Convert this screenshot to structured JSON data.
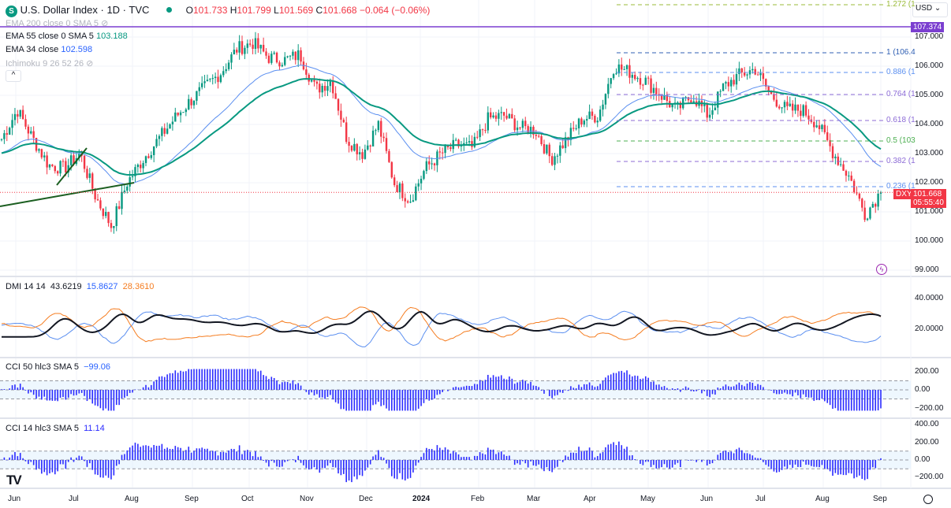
{
  "header": {
    "symbol_badge": "S",
    "title": "U.S. Dollar Index · 1D · TVC",
    "o_label": "O",
    "o": "101.733",
    "h_label": "H",
    "h": "101.799",
    "l_label": "L",
    "l": "101.569",
    "c_label": "C",
    "c": "101.668",
    "change": "−0.064 (−0.06%)"
  },
  "legend": {
    "ema200": "EMA 200 close 0 SMA 5",
    "ema55": "EMA 55 close 0 SMA 5",
    "ema55_val": "103.188",
    "ema34": "EMA 34 close",
    "ema34_val": "102.598",
    "ichimoku": "Ichimoku 9 26 52 26",
    "collapse": "^"
  },
  "currency": "USD ⌄",
  "price_axis": [
    "107.000",
    "106.000",
    "105.000",
    "104.000",
    "103.000",
    "102.000",
    "101.000",
    "100.000",
    "99.000"
  ],
  "hline": {
    "value": "107.374",
    "color": "#7b3fd0"
  },
  "last": {
    "symbol": "DXY",
    "price": "101.668",
    "countdown": "05:55:40",
    "color": "#f23645"
  },
  "fib": [
    {
      "label": "1.272 (1",
      "color": "#9bbb3a"
    },
    {
      "label": "1 (106.4",
      "color": "#2f5fb3"
    },
    {
      "label": "0.886 (1",
      "color": "#5b8ff0"
    },
    {
      "label": "0.764 (1",
      "color": "#8c6bd6"
    },
    {
      "label": "0.618 (1",
      "color": "#8c6bd6"
    },
    {
      "label": "0.5 (103",
      "color": "#4caf50"
    },
    {
      "label": "0.382 (1",
      "color": "#8c6bd6"
    },
    {
      "label": "0.236 (1",
      "color": "#5b8ff0"
    }
  ],
  "dmi": {
    "label": "DMI 14 14",
    "adx": "43.6219",
    "plus": "15.8627",
    "minus": "28.3610",
    "axis": [
      "40.0000",
      "20.0000"
    ]
  },
  "cci50": {
    "label": "CCI 50 hlc3 SMA 5",
    "value": "−99.06",
    "axis": [
      "200.00",
      "0.00",
      "−200.00"
    ]
  },
  "cci14": {
    "label": "CCI 14 hlc3 SMA 5",
    "value": "11.14",
    "axis": [
      "400.00",
      "200.00",
      "0.00",
      "−200.00"
    ]
  },
  "time_axis": [
    "Jun",
    "Jul",
    "Aug",
    "Sep",
    "Oct",
    "Nov",
    "Dec",
    "2024",
    "Feb",
    "Mar",
    "Apr",
    "May",
    "Jun",
    "Jul",
    "Aug",
    "Sep"
  ],
  "colors": {
    "up": "#089981",
    "down": "#f23645",
    "ema34": "#5b8ff0",
    "ema55": "#089981",
    "adx": "#131722",
    "di_plus": "#5b8ff0",
    "di_minus": "#f57c1f",
    "cci": "#2a2aff"
  },
  "chart_data": {
    "type": "candlestick",
    "approx_weekly_closes": [
      103.5,
      104.5,
      103.5,
      102.6,
      102.5,
      103.0,
      101.5,
      100.5,
      102.0,
      102.8,
      103.5,
      104.2,
      104.8,
      105.3,
      105.8,
      106.6,
      106.8,
      106.3,
      106.2,
      106.4,
      105.2,
      105.5,
      103.5,
      103.0,
      104.0,
      102.0,
      101.4,
      102.5,
      103.0,
      103.3,
      103.2,
      104.2,
      104.3,
      103.9,
      103.8,
      102.8,
      103.5,
      104.2,
      104.3,
      106.0,
      105.8,
      105.5,
      105.0,
      104.5,
      105.0,
      104.3,
      105.3,
      105.7,
      105.9,
      105.0,
      104.5,
      104.5,
      104.0,
      103.0,
      102.2,
      100.9,
      101.7
    ]
  }
}
